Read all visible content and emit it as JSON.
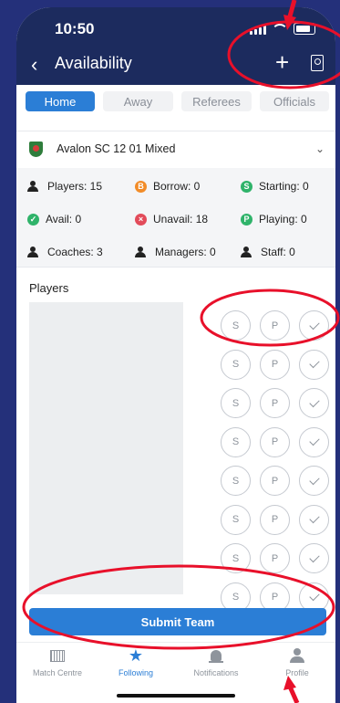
{
  "status": {
    "time": "10:50"
  },
  "header": {
    "title": "Availability",
    "back_icon": "chevron-left-icon",
    "add_icon": "plus-icon",
    "badge_icon": "id-badge-icon"
  },
  "tabs": [
    {
      "label": "Home",
      "active": true
    },
    {
      "label": "Away",
      "active": false
    },
    {
      "label": "Referees",
      "active": false
    },
    {
      "label": "Officials",
      "active": false
    }
  ],
  "team": {
    "name": "Avalon SC 12 01 Mixed"
  },
  "stats": {
    "players": "Players: 15",
    "borrow": "Borrow: 0",
    "starting": "Starting: 0",
    "avail": "Avail: 0",
    "unavail": "Unavail: 18",
    "playing": "Playing: 0",
    "coaches": "Coaches: 3",
    "managers": "Managers: 0",
    "staff": "Staff: 0",
    "badge_letters": {
      "borrow": "B",
      "starting": "S",
      "unavail": "×",
      "playing": "P"
    }
  },
  "players": {
    "heading": "Players",
    "action_labels": {
      "starting": "S",
      "playing": "P"
    },
    "row_count": 8
  },
  "submit_label": "Submit Team",
  "bottom_nav": [
    {
      "label": "Match Centre",
      "icon": "match-centre-icon",
      "active": false
    },
    {
      "label": "Following",
      "icon": "star-icon",
      "active": true
    },
    {
      "label": "Notifications",
      "icon": "bell-icon",
      "active": false
    },
    {
      "label": "Profile",
      "icon": "person-icon",
      "active": false
    }
  ],
  "colors": {
    "backdrop": "#24307a",
    "header": "#1c2b5e",
    "accent": "#2b7ed6",
    "annotation": "#e8102a",
    "green": "#2fb36a",
    "orange": "#f28c28",
    "red": "#e24b5a"
  }
}
